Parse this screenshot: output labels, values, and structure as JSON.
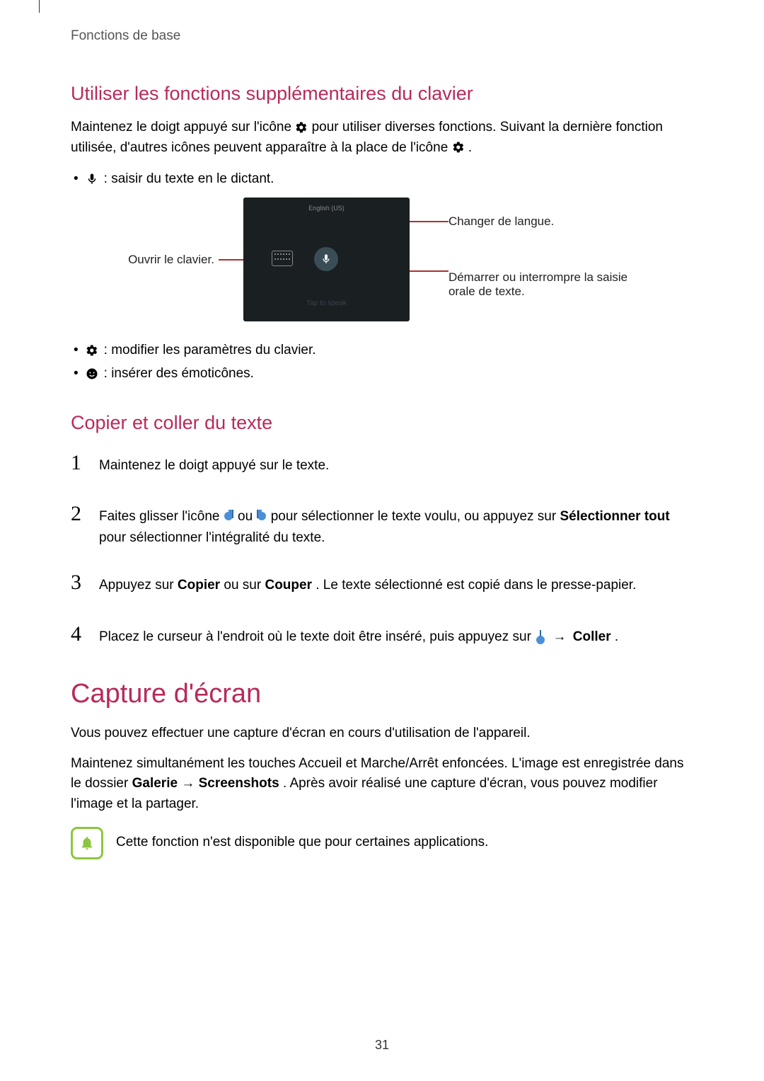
{
  "breadcrumb": "Fonctions de base",
  "section1": {
    "title": "Utiliser les fonctions supplémentaires du clavier",
    "intro": "Maintenez le doigt appuyé sur l'icône       pour utiliser diverses fonctions. Suivant la dernière fonction utilisée, d'autres icônes peuvent apparaître à la place de l'icône      .",
    "intro_a": "Maintenez le doigt appuyé sur l'icône ",
    "intro_b": " pour utiliser diverses fonctions. Suivant la dernière fonction utilisée, d'autres icônes peuvent apparaître à la place de l'icône ",
    "intro_c": ".",
    "bullet_mic": " : saisir du texte en le dictant.",
    "callout_left": "Ouvrir le clavier.",
    "callout_lang": "Changer de langue.",
    "callout_voice": "Démarrer ou interrompre la saisie orale de texte.",
    "bullet_gear": " : modifier les paramètres du clavier.",
    "bullet_smile": " : insérer des émoticônes."
  },
  "section2": {
    "title": "Copier et coller du texte",
    "steps": {
      "s1": "Maintenez le doigt appuyé sur le texte.",
      "s2a": "Faites glisser l'icône ",
      "s2b": " ou ",
      "s2c": " pour sélectionner le texte voulu, ou appuyez sur ",
      "s2_bold": "Sélectionner tout",
      "s2d": " pour sélectionner l'intégralité du texte.",
      "s3a": "Appuyez sur ",
      "s3_copy": "Copier",
      "s3b": " ou sur ",
      "s3_cut": "Couper",
      "s3c": ". Le texte sélectionné est copié dans le presse-papier.",
      "s4a": "Placez le curseur à l'endroit où le texte doit être inséré, puis appuyez sur ",
      "s4_arrow": " → ",
      "s4_paste": "Coller",
      "s4b": "."
    }
  },
  "section3": {
    "title": "Capture d'écran",
    "p1": "Vous pouvez effectuer une capture d'écran en cours d'utilisation de l'appareil.",
    "p2a": "Maintenez simultanément les touches Accueil et Marche/Arrêt enfoncées. L'image est enregistrée dans le dossier ",
    "p2_gal": "Galerie",
    "p2_arrow": " → ",
    "p2_scr": "Screenshots",
    "p2b": ". Après avoir réalisé une capture d'écran, vous pouvez modifier l'image et la partager.",
    "note": "Cette fonction n'est disponible que pour certaines applications."
  },
  "page_number": "31",
  "nums": {
    "n1": "1",
    "n2": "2",
    "n3": "3",
    "n4": "4"
  }
}
